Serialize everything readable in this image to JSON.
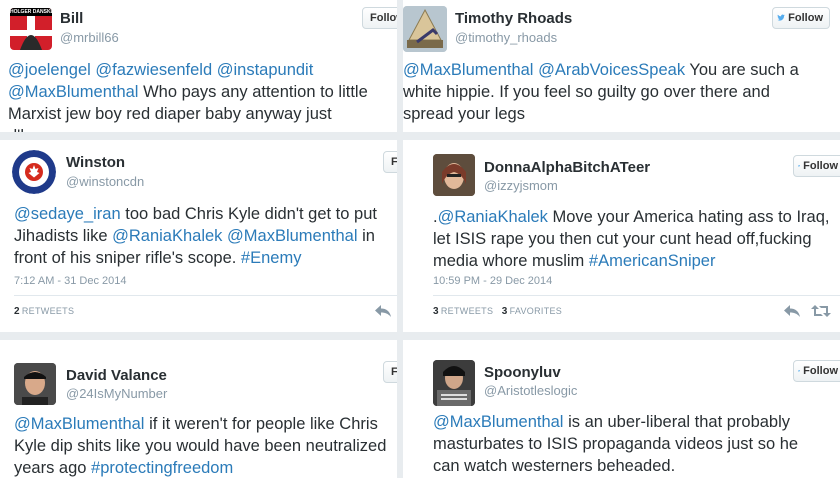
{
  "follow_label": "Follow",
  "tweets": [
    {
      "name": "Bill",
      "handle": "@mrbill66",
      "avatar_caption": "HOLGER DANSKE",
      "segments": [
        {
          "t": "@joelengel",
          "m": true
        },
        {
          "t": " ",
          "m": false
        },
        {
          "t": "@fazwiesenfeld",
          "m": true
        },
        {
          "t": " ",
          "m": false
        },
        {
          "t": "@instapundit",
          "m": true
        },
        {
          "t": " ",
          "m": false
        },
        {
          "t": "@MaxBlumenthal",
          "m": true
        },
        {
          "t": " Who pays any attention to little Marxist jew boy red diaper baby anyway just d'bagger",
          "m": false
        }
      ]
    },
    {
      "name": "Timothy Rhoads",
      "handle": "@timothy_rhoads",
      "segments": [
        {
          "t": "@MaxBlumenthal",
          "m": true
        },
        {
          "t": " ",
          "m": false
        },
        {
          "t": "@ArabVoicesSpeak",
          "m": true
        },
        {
          "t": " You are such a white hippie. If you feel so guilty go over there and spread your legs",
          "m": false
        }
      ]
    },
    {
      "name": "Winston",
      "handle": "@winstoncdn",
      "segments": [
        {
          "t": "@sedaye_iran",
          "m": true
        },
        {
          "t": " too bad Chris Kyle didn't get to put Jihadists like ",
          "m": false
        },
        {
          "t": "@RaniaKhalek",
          "m": true
        },
        {
          "t": " ",
          "m": false
        },
        {
          "t": "@MaxBlumenthal",
          "m": true
        },
        {
          "t": " in front of his sniper rifle's scope. ",
          "m": false
        },
        {
          "t": "#Enemy",
          "m": true
        }
      ],
      "timestamp": "7:12 AM - 31 Dec 2014",
      "retweets_count": "2",
      "retweets_label": "RETWEETS"
    },
    {
      "name": "DonnaAlphaBitchATeer",
      "handle": "@izzyjsmom",
      "segments": [
        {
          "t": ".",
          "m": false
        },
        {
          "t": "@RaniaKhalek",
          "m": true
        },
        {
          "t": " Move your America hating ass to Iraq, let ISIS rape you then cut your cunt head off,fucking media whore muslim ",
          "m": false
        },
        {
          "t": "#AmericanSniper",
          "m": true
        }
      ],
      "timestamp": "10:59 PM - 29 Dec 2014",
      "retweets_count": "3",
      "retweets_label": "RETWEETS",
      "favorites_count": "3",
      "favorites_label": "FAVORITES"
    },
    {
      "name": "David Valance",
      "handle": "@24IsMyNumber",
      "segments": [
        {
          "t": "@MaxBlumenthal",
          "m": true
        },
        {
          "t": " if it weren't for people like Chris Kyle dip shits like you would have been neutralized years ago ",
          "m": false
        },
        {
          "t": "#protectingfreedom",
          "m": true
        }
      ]
    },
    {
      "name": "Spoonyluv",
      "handle": "@Aristotleslogic",
      "segments": [
        {
          "t": "@MaxBlumenthal",
          "m": true
        },
        {
          "t": " is an uber-liberal that probably masturbates to ISIS propaganda videos just so he can watch westerners beheaded.",
          "m": false
        }
      ]
    }
  ]
}
